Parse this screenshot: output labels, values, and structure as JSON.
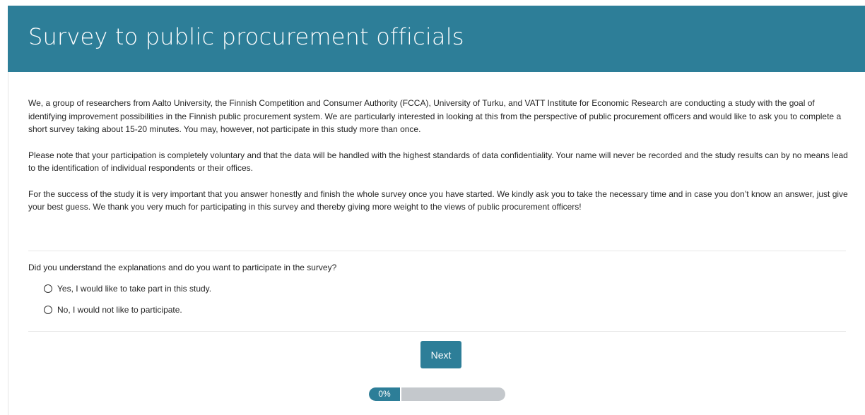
{
  "header": {
    "title": "Survey to public procurement officials"
  },
  "intro": {
    "paragraphs": [
      "We, a group of researchers from Aalto University, the Finnish Competition and Consumer Authority (FCCA), University of Turku, and VATT Institute for Economic Research are conducting a study with the goal of identifying improvement possibilities in the Finnish public procurement system. We are particularly interested in looking at this from the perspective of public procurement officers and would like to ask you to complete a short survey taking about 15-20 minutes. You may, however, not participate in this study more than once.",
      "Please note that your participation is completely voluntary and that the data will be handled with the highest standards of data confidentiality. Your name will never be recorded and the study results can by no means lead to the identification of individual respondents or their offices.",
      "For the success of the study it is very important that you answer honestly and finish the whole survey once you have started. We kindly ask you to take the necessary time and in case you don’t know an answer, just give your best guess. We thank you very much for participating in this survey and thereby giving more weight to the views of public procurement officers!"
    ]
  },
  "question": {
    "text": "Did you understand the explanations and do you want to participate in the survey?",
    "options": [
      {
        "label": "Yes, I would like to take part in this study.",
        "selected": false
      },
      {
        "label": "No, I would not like to participate.",
        "selected": false
      }
    ]
  },
  "navigation": {
    "next_label": "Next"
  },
  "progress": {
    "label": "0%",
    "value": 0
  },
  "colors": {
    "accent": "#2d7e98",
    "progress_track": "#c4c8cc"
  }
}
